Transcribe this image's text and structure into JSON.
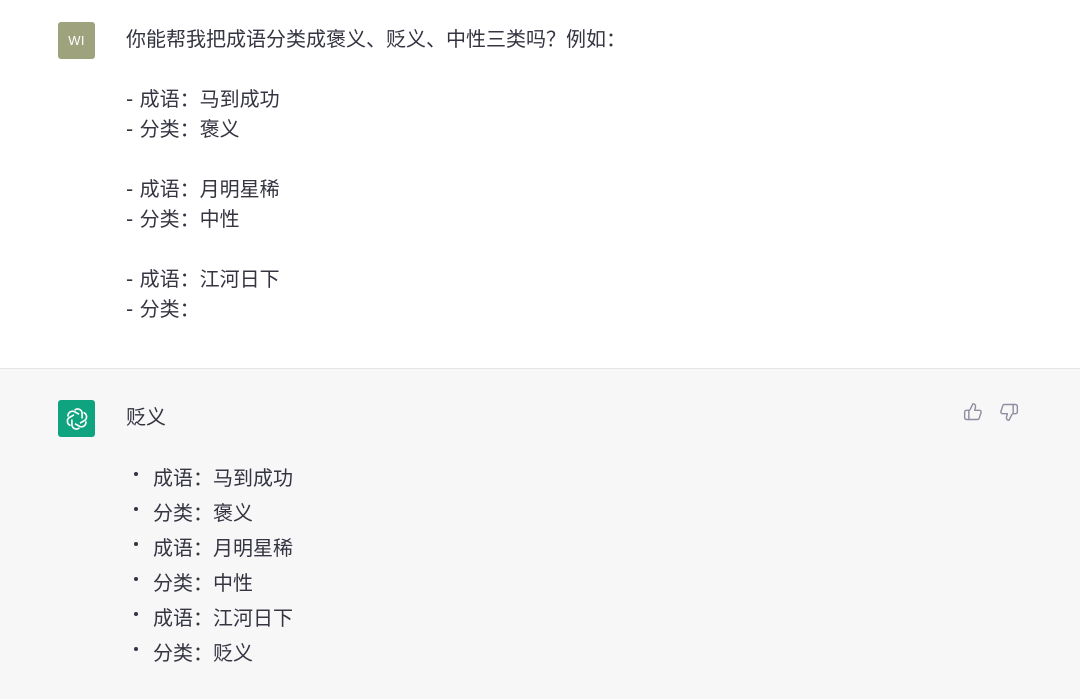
{
  "user": {
    "avatar_initials": "WI",
    "lines": [
      "你能帮我把成语分类成褒义、贬义、中性三类吗？例如：",
      "",
      "- 成语：马到成功",
      "- 分类：褒义",
      "",
      "- 成语：月明星稀",
      "- 分类：中性",
      "",
      "- 成语：江河日下",
      "- 分类："
    ]
  },
  "assistant": {
    "avatar_icon": "openai-logo-icon",
    "answer": "贬义",
    "items": [
      "成语：马到成功",
      "分类：褒义",
      "成语：月明星稀",
      "分类：中性",
      "成语：江河日下",
      "分类：贬义"
    ],
    "feedback": {
      "like_icon": "thumbs-up-icon",
      "dislike_icon": "thumbs-down-icon"
    }
  },
  "colors": {
    "text": "#343541",
    "user_avatar": "#9ea37e",
    "bot_avatar": "#10a37f",
    "assistant_bg": "#f7f7f8",
    "icon": "#8e8ea0"
  }
}
